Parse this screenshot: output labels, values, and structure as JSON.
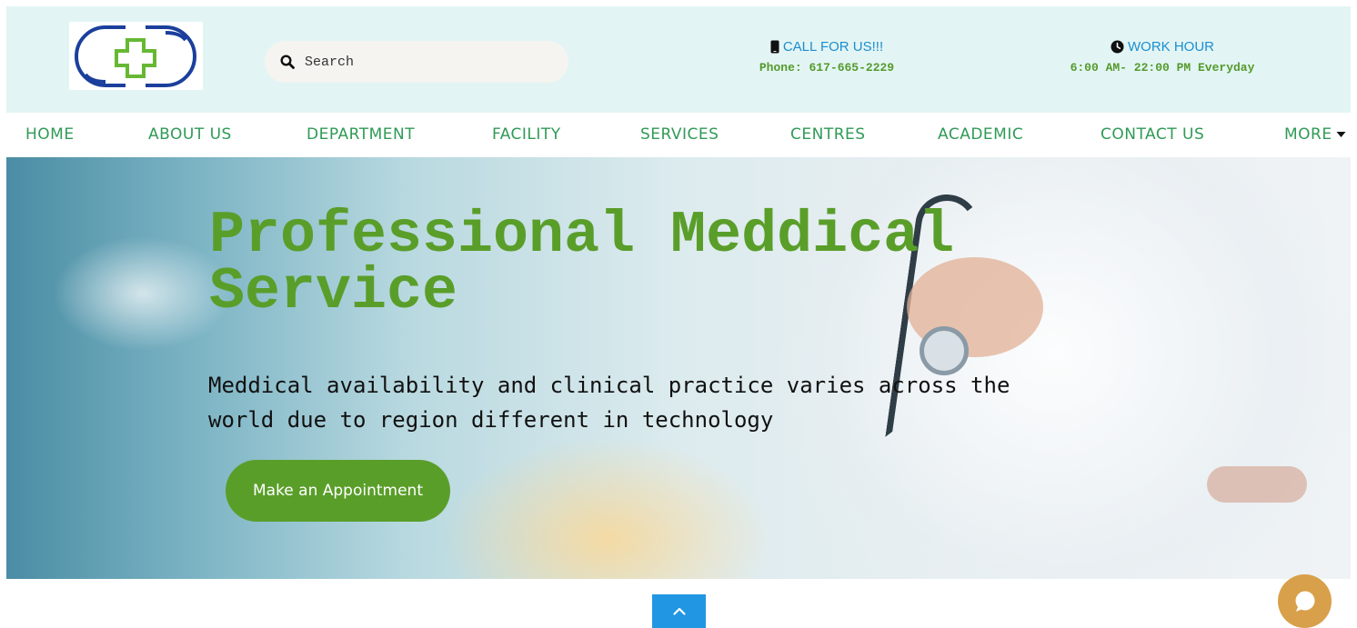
{
  "header": {
    "search": {
      "placeholder": "Search"
    },
    "call": {
      "title": "CALL FOR US!!!",
      "value": "Phone: 617-665-2229"
    },
    "hours": {
      "title": "WORK HOUR",
      "value": "6:00 AM- 22:00 PM Everyday"
    }
  },
  "nav": {
    "items": [
      "HOME",
      "ABOUT US",
      "DEPARTMENT",
      "FACILITY",
      "SERVICES",
      "CENTRES",
      "ACADEMIC",
      "CONTACT US",
      "MORE"
    ]
  },
  "hero": {
    "title_line1": "Professional Meddical",
    "title_line2": "Service",
    "subtitle_line1": "Meddical availability and clinical practice varies across the",
    "subtitle_line2": "world due to region different in technology",
    "cta_label": "Make an Appointment"
  },
  "colors": {
    "brand_green": "#5a9e2a",
    "nav_green": "#2f9a56",
    "link_blue": "#1c8ed0",
    "header_bg": "#e2f5f4",
    "scroll_button": "#2196e3",
    "chat_button": "#d8a04a",
    "logo_blue": "#1b3f9c"
  },
  "icons": {
    "logo": "medical-cross-capsule-logo",
    "search": "search-icon",
    "phone": "phone-icon",
    "clock": "clock-icon",
    "more": "caret-down-icon",
    "scroll_top": "chevron-up-icon",
    "chat": "chat-bubble-icon"
  }
}
